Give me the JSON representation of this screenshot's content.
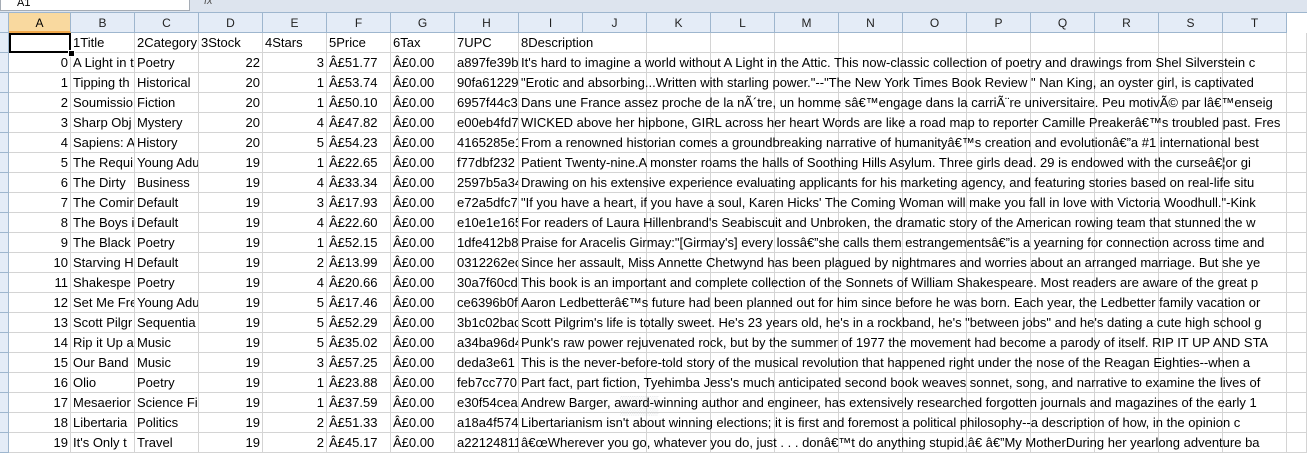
{
  "formula_bar": {
    "name_box": "A1",
    "fx_label": "fx"
  },
  "columns": [
    "A",
    "B",
    "C",
    "D",
    "E",
    "F",
    "G",
    "H",
    "I",
    "J",
    "K",
    "L",
    "M",
    "N",
    "O",
    "P",
    "Q",
    "R",
    "S",
    "T"
  ],
  "header_row": [
    "",
    "1Title",
    "2Category",
    "3Stock",
    "4Stars",
    "5Price",
    "6Tax",
    "7UPC",
    "8Description"
  ],
  "rows": [
    [
      "0",
      "A Light in t",
      "Poetry",
      "22",
      "3",
      "Â£51.77",
      "Â£0.00",
      "a897fe39b",
      "It's hard to imagine a world without A Light in the Attic. This now-classic collection of poetry and drawings from Shel Silverstein c"
    ],
    [
      "1",
      "Tipping th",
      "Historical",
      "20",
      "1",
      "Â£53.74",
      "Â£0.00",
      "90fa61229",
      "\"Erotic and absorbing...Written with starling power.\"--\"The New York Times Book Review \" Nan King, an oyster girl, is captivated"
    ],
    [
      "2",
      "Soumissio",
      "Fiction",
      "20",
      "1",
      "Â£50.10",
      "Â£0.00",
      "6957f44c3",
      "Dans une France assez proche de la nÃ´tre, un homme sâ€™engage dans la carriÃ¨re universitaire. Peu motivÃ© par lâ€™enseig"
    ],
    [
      "3",
      "Sharp Obj",
      "Mystery",
      "20",
      "4",
      "Â£47.82",
      "Â£0.00",
      "e00eb4fd7",
      "WICKED above her hipbone, GIRL across her heart Words are like a road map to reporter Camille Preakerâ€™s troubled past. Fres"
    ],
    [
      "4",
      "Sapiens: A",
      "History",
      "20",
      "5",
      "Â£54.23",
      "Â£0.00",
      "4165285e1",
      "From a renowned historian comes a groundbreaking narrative of humanityâ€™s creation and evolutionâ€”a #1 international best"
    ],
    [
      "5",
      "The Requi",
      "Young Adu",
      "19",
      "1",
      "Â£22.65",
      "Â£0.00",
      "f77dbf232",
      "Patient Twenty-nine.A monster roams the halls of Soothing Hills Asylum. Three girls dead. 29 is endowed with the curseâ€¦or gi"
    ],
    [
      "6",
      "The Dirty",
      "Business",
      "19",
      "4",
      "Â£33.34",
      "Â£0.00",
      "2597b5a34",
      "Drawing on his extensive experience evaluating applicants for his marketing agency, and featuring stories based on real-life situ"
    ],
    [
      "7",
      "The Comir",
      "Default",
      "19",
      "3",
      "Â£17.93",
      "Â£0.00",
      "e72a5dfc7",
      "\"If you have a heart, if you have a soul, Karen Hicks' The Coming Woman will make you fall in love with Victoria Woodhull.\"-Kink"
    ],
    [
      "8",
      "The Boys i",
      "Default",
      "19",
      "4",
      "Â£22.60",
      "Â£0.00",
      "e10e1e165",
      "For readers of Laura Hillenbrand's Seabiscuit and Unbroken, the dramatic story of the American rowing team that stunned the w"
    ],
    [
      "9",
      "The Black",
      "Poetry",
      "19",
      "1",
      "Â£52.15",
      "Â£0.00",
      "1dfe412b8",
      "Praise for Aracelis Girmay:\"[Girmay's] every lossâ€”she calls them estrangementsâ€”is a yearning for connection across time and"
    ],
    [
      "10",
      "Starving H",
      "Default",
      "19",
      "2",
      "Â£13.99",
      "Â£0.00",
      "0312262ec",
      "Since her assault, Miss Annette Chetwynd has been plagued by nightmares and worries about an arranged marriage. But she ye"
    ],
    [
      "11",
      "Shakespe",
      "Poetry",
      "19",
      "4",
      "Â£20.66",
      "Â£0.00",
      "30a7f60cd",
      "This book is an important and complete collection of the Sonnets of William Shakespeare. Most readers are aware of the great p"
    ],
    [
      "12",
      "Set Me Fre",
      "Young Adu",
      "19",
      "5",
      "Â£17.46",
      "Â£0.00",
      "ce6396b0f",
      "Aaron Ledbetterâ€™s future had been planned out for him since before he was born. Each year, the Ledbetter family vacation or"
    ],
    [
      "13",
      "Scott Pilgr",
      "Sequentia",
      "19",
      "5",
      "Â£52.29",
      "Â£0.00",
      "3b1c02bac",
      "Scott Pilgrim's life is totally sweet. He's 23 years old, he's in a rockband, he's \"between jobs\" and he's dating a cute high school g"
    ],
    [
      "14",
      "Rip it Up a",
      "Music",
      "19",
      "5",
      "Â£35.02",
      "Â£0.00",
      "a34ba96d4",
      "Punk's raw power rejuvenated rock, but by the summer of 1977 the movement had become a parody of itself. RIP IT UP AND STA"
    ],
    [
      "15",
      "Our Band",
      "Music",
      "19",
      "3",
      "Â£57.25",
      "Â£0.00",
      "deda3e61",
      "This is the never-before-told story of the musical revolution that happened right under the nose of the Reagan Eighties--when a"
    ],
    [
      "16",
      "Olio",
      "Poetry",
      "19",
      "1",
      "Â£23.88",
      "Â£0.00",
      "feb7cc770",
      "Part fact, part fiction, Tyehimba Jess's much anticipated second book weaves sonnet, song, and narrative to examine the lives of"
    ],
    [
      "17",
      "Mesaerior",
      "Science Fi",
      "19",
      "1",
      "Â£37.59",
      "Â£0.00",
      "e30f54cea",
      "Andrew Barger, award-winning author and engineer, has extensively researched forgotten journals and magazines of the early 1"
    ],
    [
      "18",
      "Libertaria",
      "Politics",
      "19",
      "2",
      "Â£51.33",
      "Â£0.00",
      "a18a4f574",
      "Libertarianism isn't about winning elections; it is first and foremost a political philosophy--a description of how, in the opinion c"
    ],
    [
      "19",
      "It's Only t",
      "Travel",
      "19",
      "2",
      "Â£45.17",
      "Â£0.00",
      "a22124811",
      "â€œWherever you go, whatever you do, just . . . donâ€™t do anything stupid.â€ â€”My MotherDuring her yearlong adventure ba"
    ]
  ]
}
